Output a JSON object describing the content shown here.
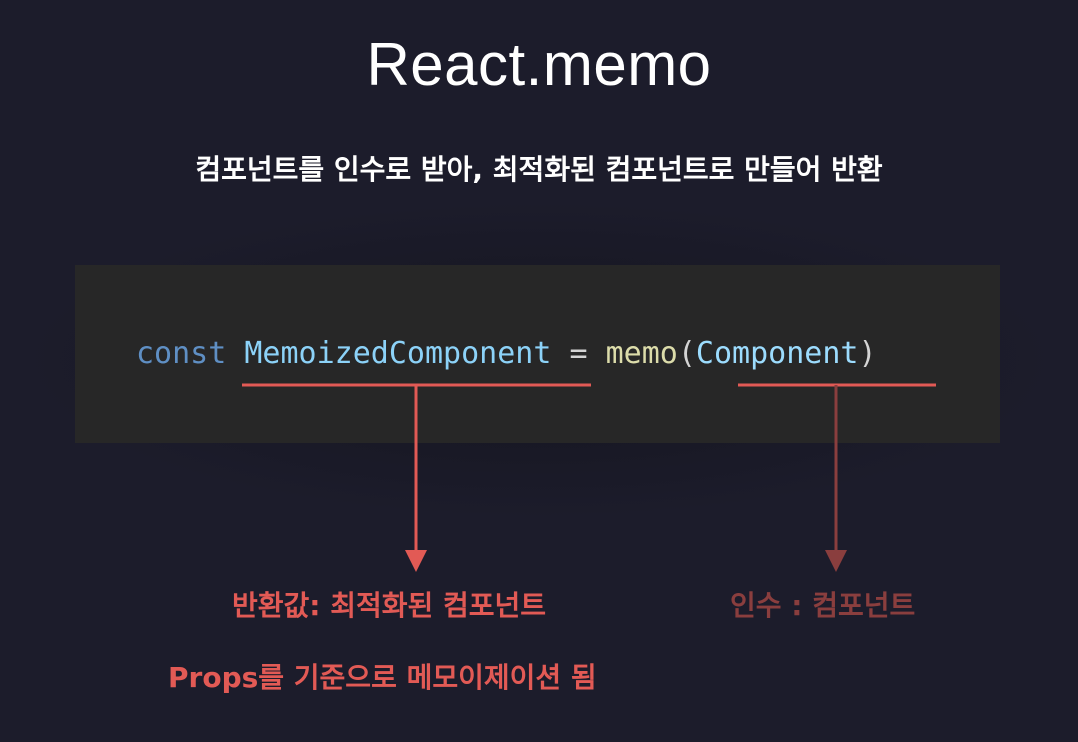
{
  "title": "React.memo",
  "subtitle": "컴포넌트를 인수로 받아, 최적화된 컴포넌트로 만들어 반환",
  "code": {
    "keyword": "const",
    "variable": "MemoizedComponent",
    "operator": "=",
    "function": "memo",
    "paren_open": "(",
    "argument": "Component",
    "paren_close": ")"
  },
  "annotations": {
    "return_label": "반환값: 최적화된 컴포넌트",
    "memo_note": "Props를 기준으로 메모이제이션 됨",
    "argument_label": "인수 : 컴포넌트"
  },
  "colors": {
    "background": "#1c1c2b",
    "code_background": "#272727",
    "accent_red": "#e25a55",
    "muted_red": "#8a3e3e"
  }
}
